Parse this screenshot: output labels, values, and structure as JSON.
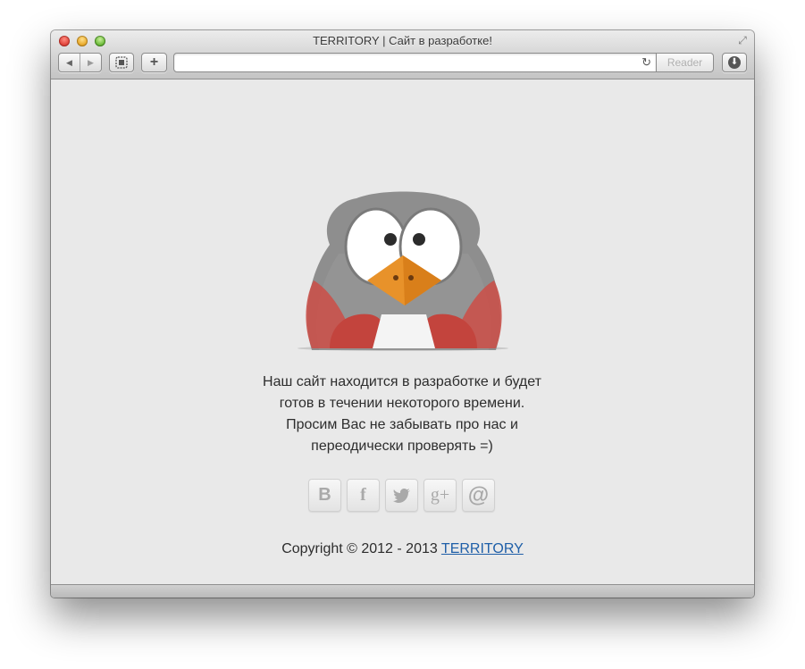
{
  "window": {
    "title": "TERRITORY | Сайт в разработке!"
  },
  "toolbar": {
    "back_icon": "back-arrow-icon",
    "forward_icon": "forward-arrow-icon",
    "tabs_icon": "tab-overview-icon",
    "new_tab_label": "+",
    "url_value": "",
    "reader_label": "Reader",
    "reload_icon": "reload-icon",
    "downloads_icon": "download-icon"
  },
  "page": {
    "mascot": "penguin-mascot",
    "message_lines": [
      "Наш сайт находится в разработке и будет",
      "готов в течении некоторого времени.",
      "Просим Вас не забывать про нас и",
      "переодически проверять =)"
    ],
    "socials": [
      {
        "name": "vk",
        "glyph": "B"
      },
      {
        "name": "facebook",
        "glyph": "f"
      },
      {
        "name": "twitter",
        "glyph": ""
      },
      {
        "name": "google-plus",
        "glyph": "g+"
      },
      {
        "name": "email",
        "glyph": "@"
      }
    ],
    "copyright_prefix": "Copyright © 2012 - 2013 ",
    "copyright_link": "TERRITORY"
  },
  "colors": {
    "page_bg": "#e9e9e9",
    "link": "#1f5fa8",
    "text": "#2d2d2d",
    "mascot_body": "#8e8e8e",
    "mascot_beak": "#e8922a",
    "mascot_wing": "#c9514a"
  }
}
